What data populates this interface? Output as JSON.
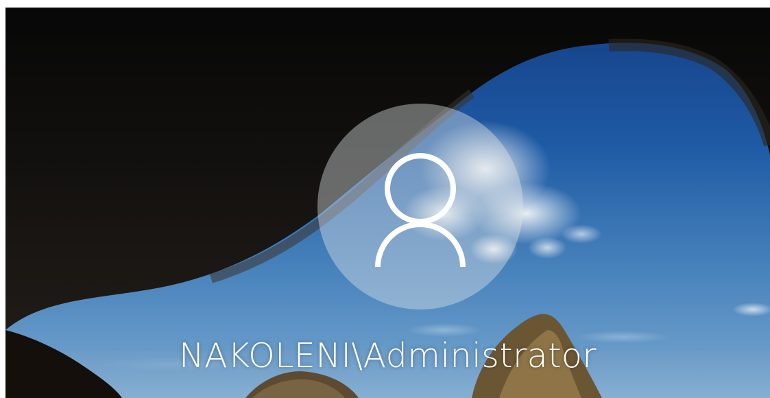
{
  "lockscreen": {
    "username": "NAKOLENI\\Administrator",
    "avatar_icon": "user-icon"
  },
  "colors": {
    "sky_top": "#1a4f9a",
    "sky_bottom": "#5b92c4",
    "cave_rock": "#0d0d0d",
    "text": "#ffffff"
  }
}
